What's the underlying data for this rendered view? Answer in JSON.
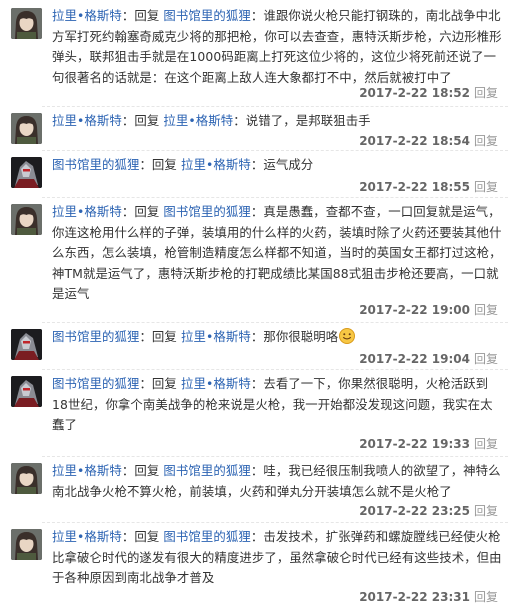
{
  "colors": {
    "link": "#2d64b3",
    "text": "#333333",
    "time": "#666666",
    "reply_link": "#999999"
  },
  "replies": [
    {
      "avatar": "girl-soldier-avatar",
      "user": "拉里•格斯特",
      "verb": "：回复",
      "target": "图书馆里的狐狸",
      "text": "：谁跟你说火枪只能打钢珠的，南北战争中北方军打死约翰塞奇威克少将的那把枪，你可以去查查，惠特沃斯步枪，六边形椎形弹头，联邦狙击手就是在1000码距离上打死这位少将的，这位少将死前还说了一句很著名的话就是：在这个距离上敌人连大象都打不中，然后就被打中了",
      "time": "2017-2-22 18:52",
      "reply_label": "回复"
    },
    {
      "avatar": "girl-soldier-avatar",
      "user": "拉里•格斯特",
      "verb": "：回复",
      "target": "拉里•格斯特",
      "text": "：说错了，是邦联狙击手",
      "time": "2017-2-22 18:54",
      "reply_label": "回复"
    },
    {
      "avatar": "robot-avatar",
      "user": "图书馆里的狐狸",
      "verb": "：回复",
      "target": "拉里•格斯特",
      "text": "：运气成分",
      "time": "2017-2-22 18:55",
      "reply_label": "回复"
    },
    {
      "avatar": "girl-soldier-avatar",
      "user": "拉里•格斯特",
      "verb": "：回复",
      "target": "图书馆里的狐狸",
      "text": "：真是愚蠢，查都不查，一口回复就是运气，你连这枪用什么样的子弹，装填用的什么样的火药，装填时除了火药还要装其他什么东西，怎么装填，枪管制造精度怎么样都不知道，当时的英国女王都打过这枪，神TM就是运气了，惠特沃斯步枪的打靶成绩比某国88式狙击步枪还要高，一口就是运气",
      "time": "2017-2-22 19:00",
      "reply_label": "回复"
    },
    {
      "avatar": "robot-avatar",
      "user": "图书馆里的狐狸",
      "verb": "：回复",
      "target": "拉里•格斯特",
      "text": "：那你很聪明咯",
      "emoji": "smile-emoji",
      "time": "2017-2-22 19:04",
      "reply_label": "回复"
    },
    {
      "avatar": "robot-avatar",
      "user": "图书馆里的狐狸",
      "verb": "：回复",
      "target": "拉里•格斯特",
      "text": "：去看了一下，你果然很聪明，火枪活跃到18世纪，你拿个南美战争的枪来说是火枪，我一开始都没发现这问题，我实在太蠢了",
      "time": "2017-2-22 19:33",
      "reply_label": "回复"
    },
    {
      "avatar": "girl-soldier-avatar",
      "user": "拉里•格斯特",
      "verb": "：回复",
      "target": "图书馆里的狐狸",
      "text": "：哇，我已经很压制我喷人的欲望了，神特么南北战争火枪不算火枪，前装填，火药和弹丸分开装填怎么就不是火枪了",
      "time": "2017-2-22 23:25",
      "reply_label": "回复"
    },
    {
      "avatar": "girl-soldier-avatar",
      "user": "拉里•格斯特",
      "verb": "：回复",
      "target": "图书馆里的狐狸",
      "text": "：击发技术，扩张弹药和螺旋膛线已经使火枪比拿破仑时代的遂发有很大的精度进步了，虽然拿破仑时代已经有这些技术，但由于各种原因到南北战争才普及",
      "time": "2017-2-22 23:31",
      "reply_label": "回复"
    }
  ]
}
